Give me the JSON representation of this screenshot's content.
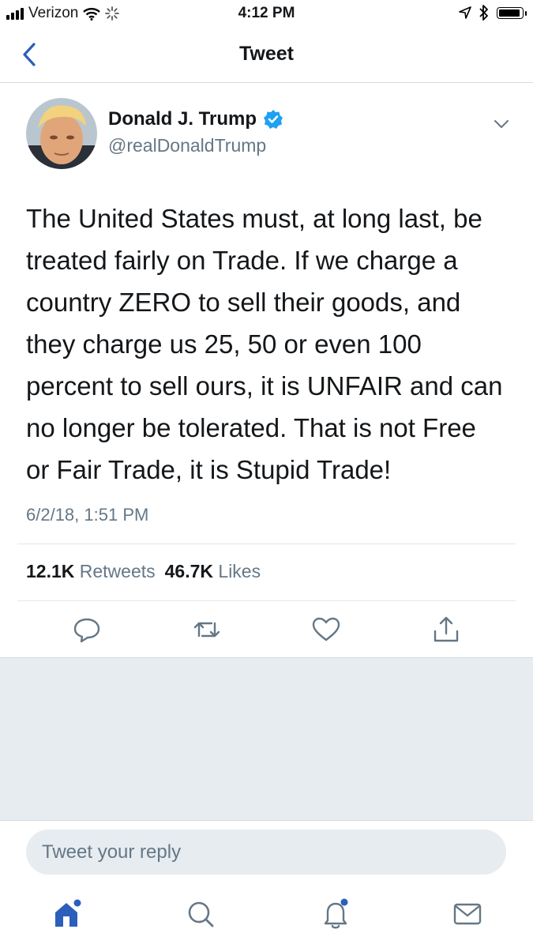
{
  "status_bar": {
    "carrier": "Verizon",
    "time": "4:12 PM"
  },
  "nav": {
    "title": "Tweet"
  },
  "author": {
    "name": "Donald J. Trump",
    "handle": "@realDonaldTrump",
    "verified": true
  },
  "tweet": {
    "lines": [
      "The United States must, at long last, be",
      "treated fairly on Trade. If we charge a",
      "country ZERO to sell their goods, and",
      "they charge us 25, 50 or even 100",
      "percent to sell ours, it is UNFAIR and can",
      "no longer be tolerated. That is not Free",
      "or Fair Trade, it is Stupid Trade!"
    ],
    "timestamp": "6/2/18, 1:51 PM"
  },
  "stats": {
    "retweets_count": "12.1K",
    "retweets_label": "Retweets",
    "likes_count": "46.7K",
    "likes_label": "Likes"
  },
  "reply": {
    "placeholder": "Tweet your reply"
  },
  "colors": {
    "accent": "#1da1f2",
    "nav_blue": "#2c5ebc",
    "verified": "#1da1f2",
    "secondary_text": "#657786",
    "gray_bg": "#e6ecf0"
  },
  "icons": {
    "actions": [
      "reply-icon",
      "retweet-icon",
      "like-icon",
      "share-icon"
    ],
    "tabs": [
      "home-icon",
      "search-icon",
      "notifications-icon",
      "messages-icon"
    ]
  }
}
